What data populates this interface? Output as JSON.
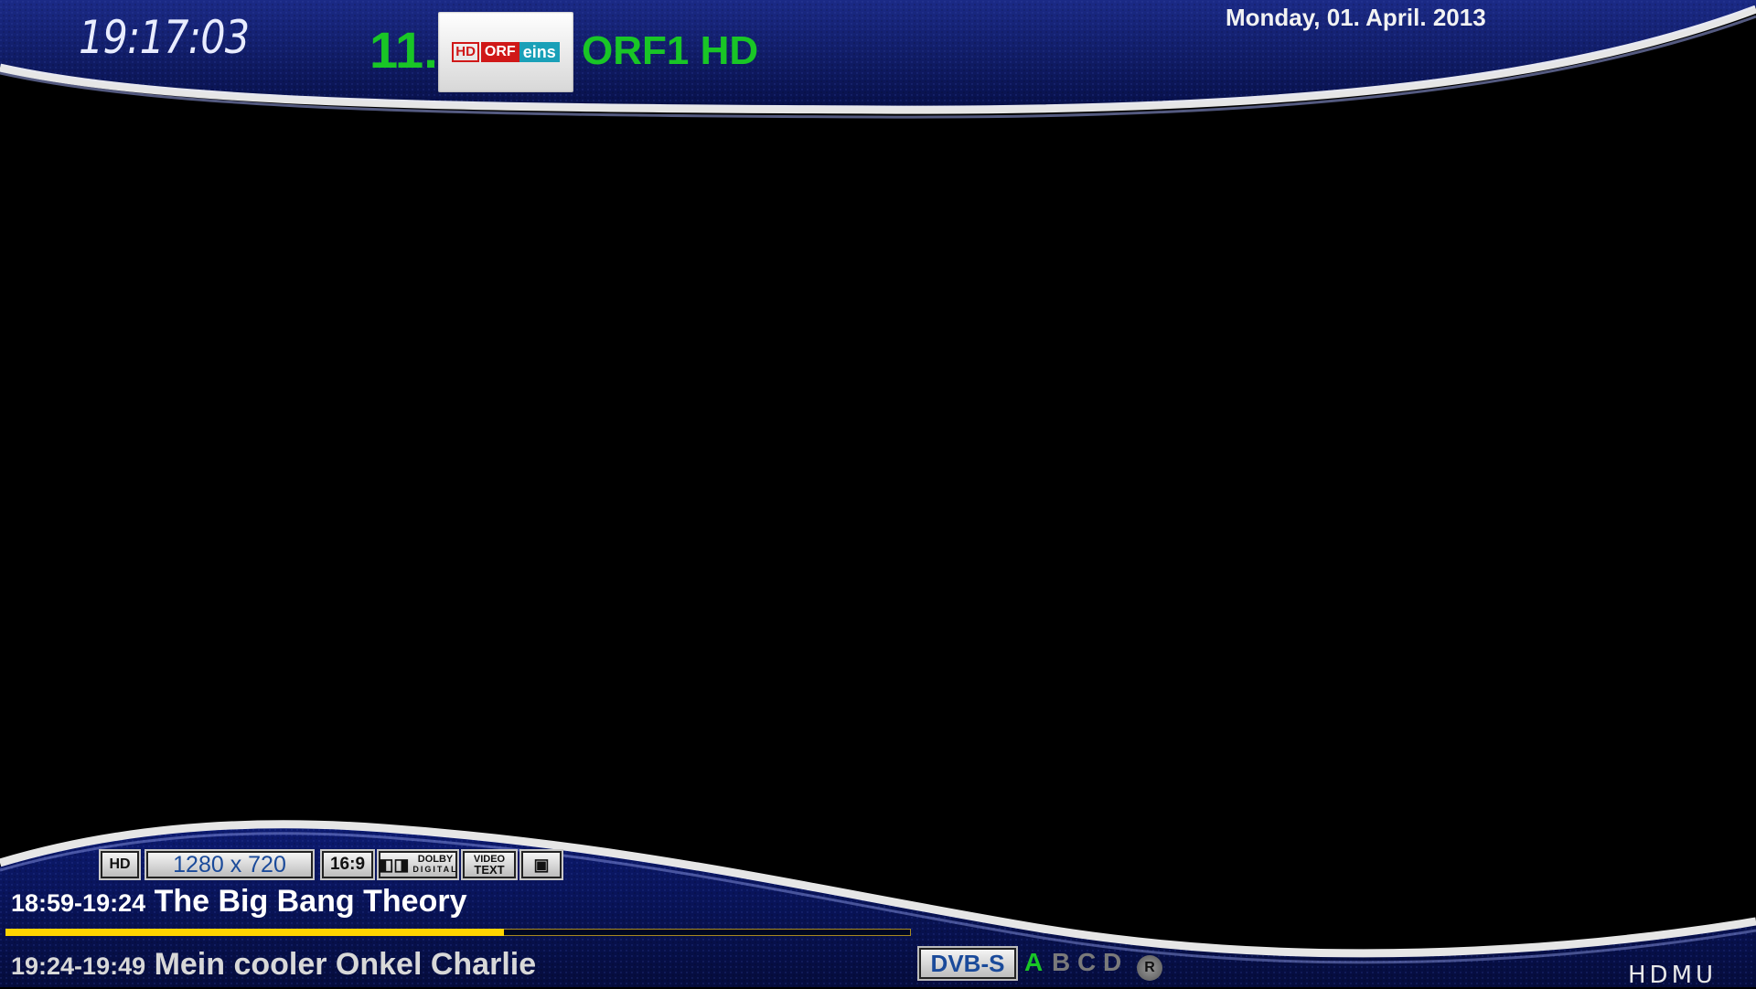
{
  "header": {
    "clock": "19:17:03",
    "channel_number": "11.",
    "channel_name": "ORF1 HD",
    "date": "Monday, 01. April. 2013",
    "logo": {
      "hd": "HD",
      "orf": "ORF",
      "eins": "eins"
    }
  },
  "stream_info": {
    "hd_label": "HD",
    "resolution": "1280 x 720",
    "aspect": "16:9",
    "dolby_top": "DOLBY",
    "dolby_bottom": "DIGITAL",
    "videotext_top": "VIDEO",
    "videotext_bottom": "TEXT",
    "subtitle_icon": "subtitle-icon"
  },
  "epg": {
    "current": {
      "time": "18:59-19:24",
      "title": "The Big Bang Theory",
      "progress": 0.55
    },
    "next": {
      "time": "19:24-19:49",
      "title": "Mein cooler Onkel Charlie"
    }
  },
  "tuner": {
    "system": "DVB-S",
    "slots": [
      "A",
      "B",
      "C",
      "D"
    ],
    "active_slot": "A",
    "record_icon": "R"
  },
  "brand": "HDMU",
  "colors": {
    "accent_green": "#19c626",
    "progress_yellow": "#ffd400",
    "panel_blue": "#0c1a6e"
  }
}
